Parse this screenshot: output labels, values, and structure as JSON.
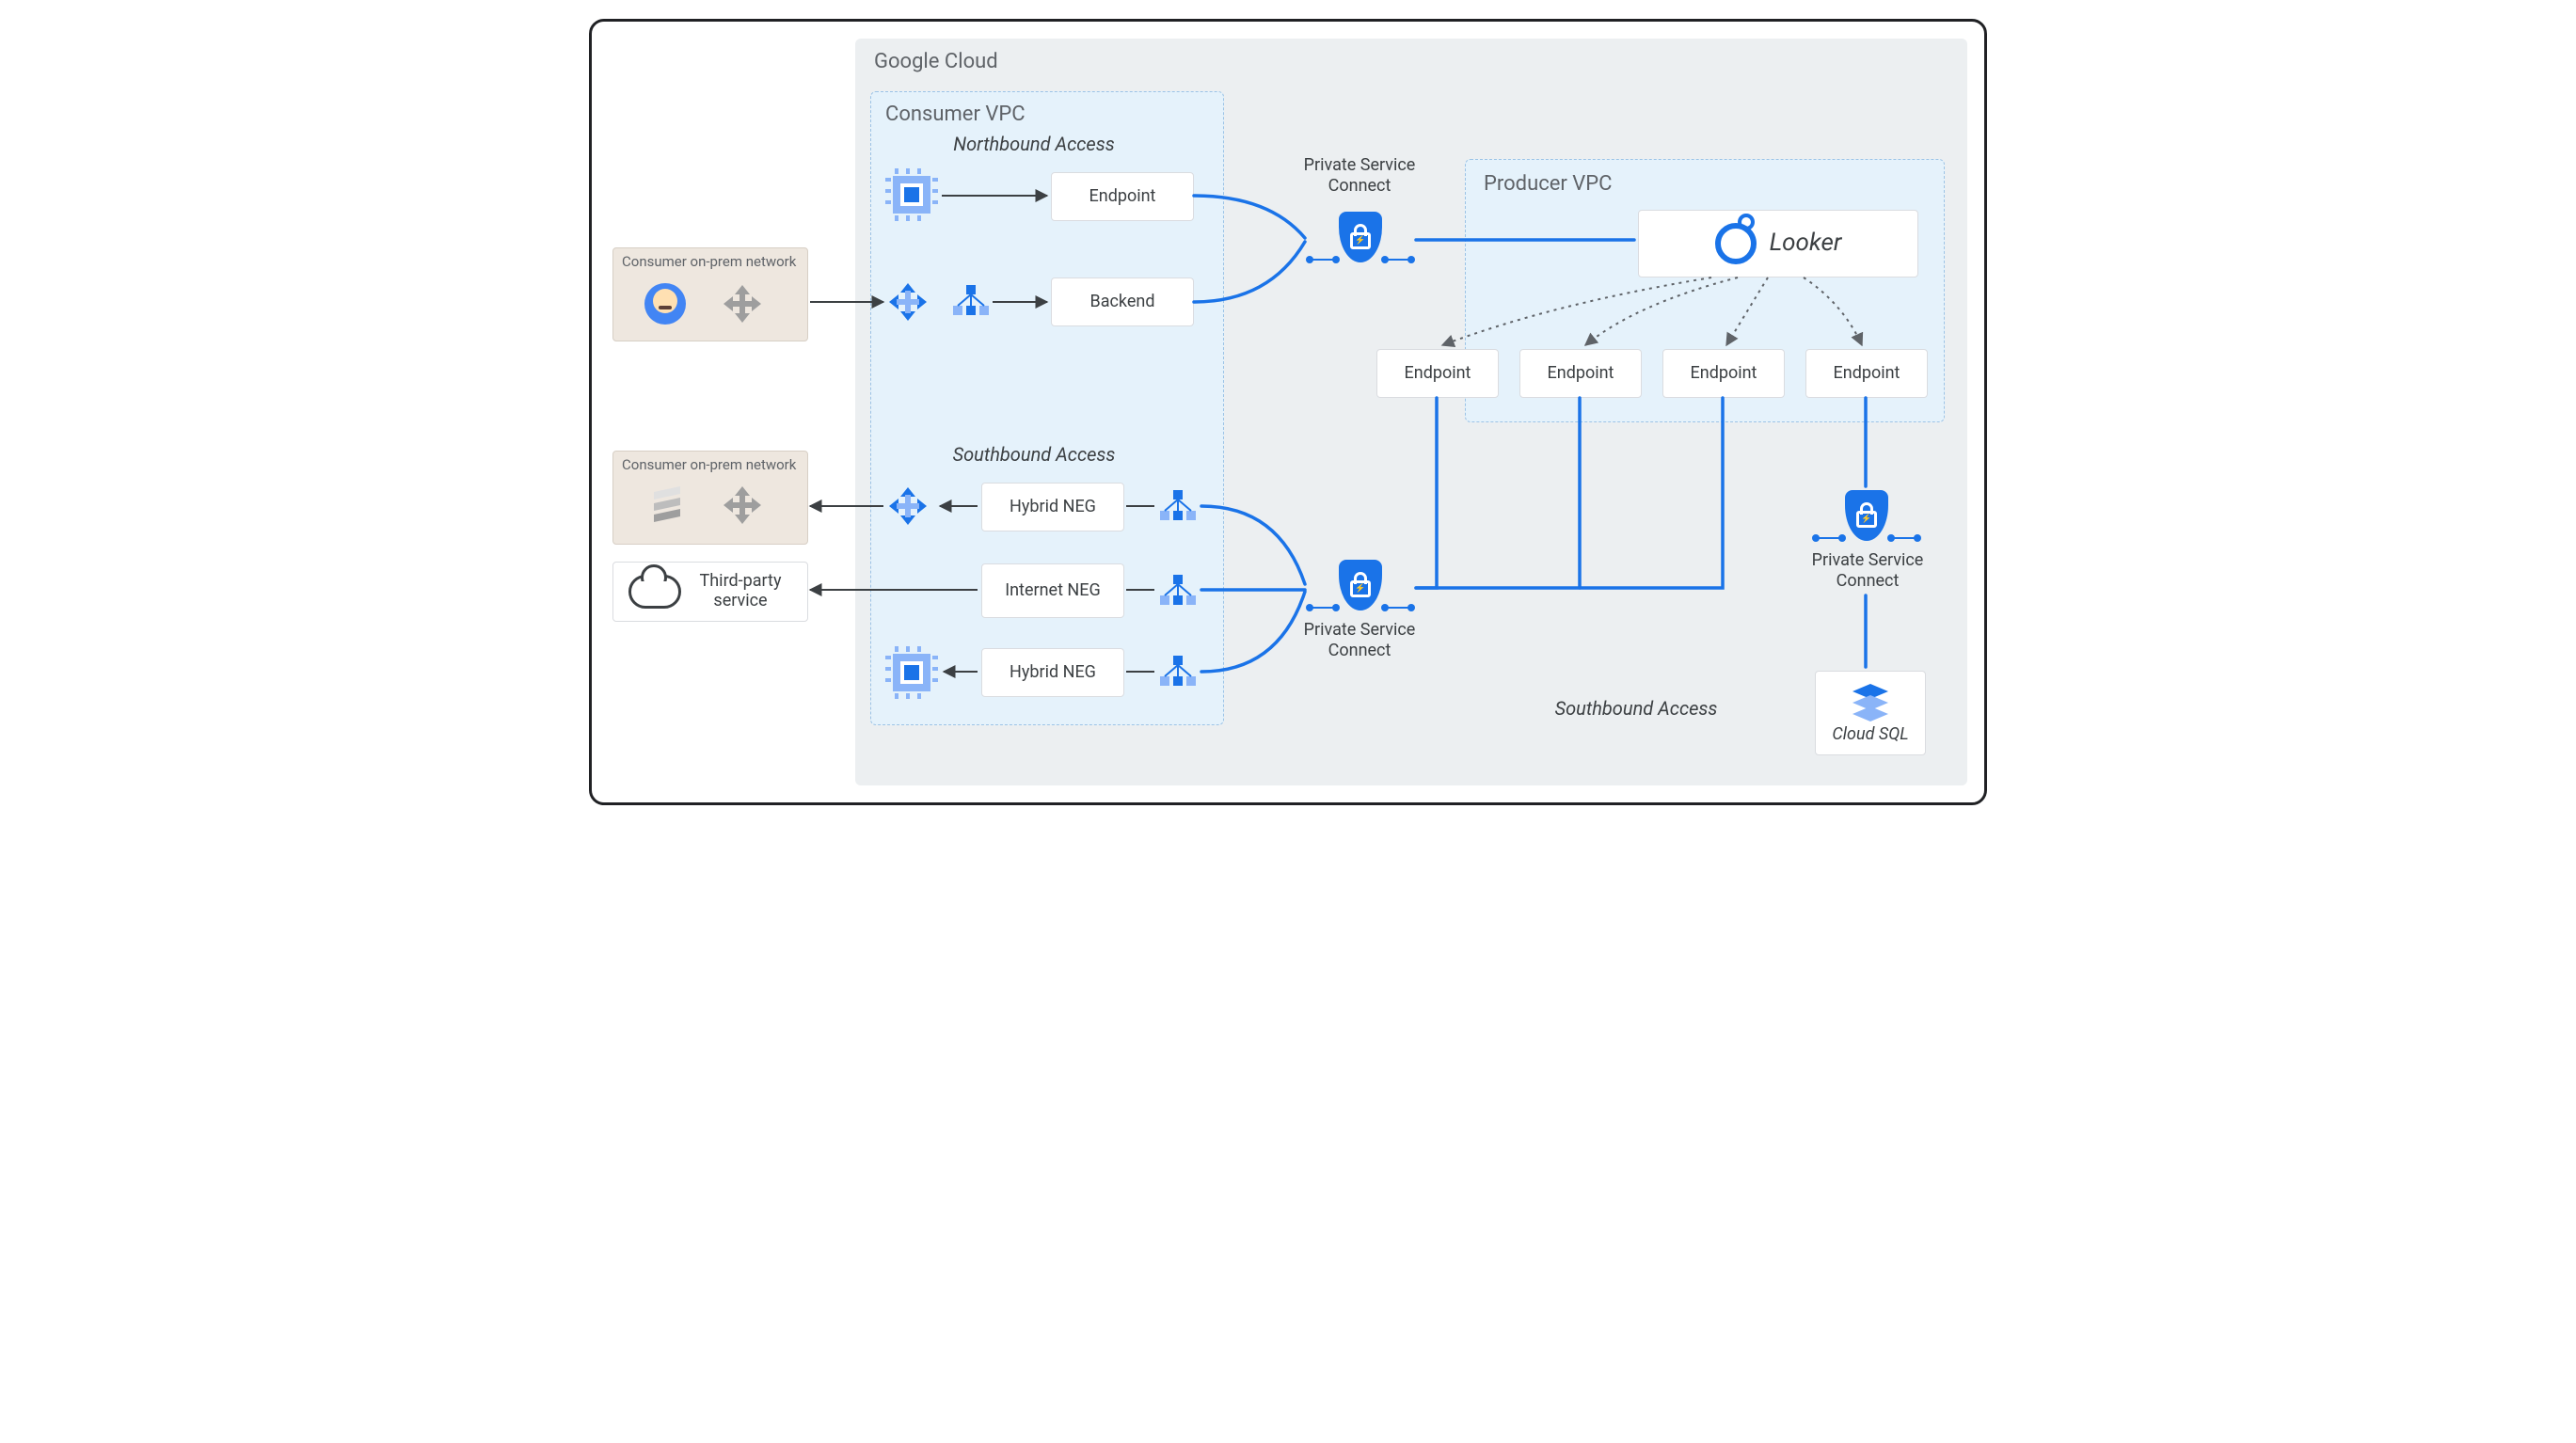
{
  "regions": {
    "gcp": "Google Cloud",
    "consumer_vpc": "Consumer VPC",
    "producer_vpc": "Producer VPC",
    "onprem1": "Consumer on-prem network",
    "onprem2": "Consumer on-prem network"
  },
  "sections": {
    "northbound": "Northbound Access",
    "southbound_left": "Southbound Access",
    "southbound_right": "Southbound Access"
  },
  "nodes": {
    "endpoint_nb": "Endpoint",
    "backend": "Backend",
    "hybrid_neg_1": "Hybrid NEG",
    "internet_neg": "Internet NEG",
    "hybrid_neg_2": "Hybrid NEG",
    "looker": "Looker",
    "endpoint1": "Endpoint",
    "endpoint2": "Endpoint",
    "endpoint3": "Endpoint",
    "endpoint4": "Endpoint",
    "third_party": "Third-party service",
    "cloud_sql": "Cloud SQL"
  },
  "labels": {
    "psc_top": "Private Service Connect",
    "psc_bottom": "Private Service Connect",
    "psc_right": "Private Service Connect"
  }
}
